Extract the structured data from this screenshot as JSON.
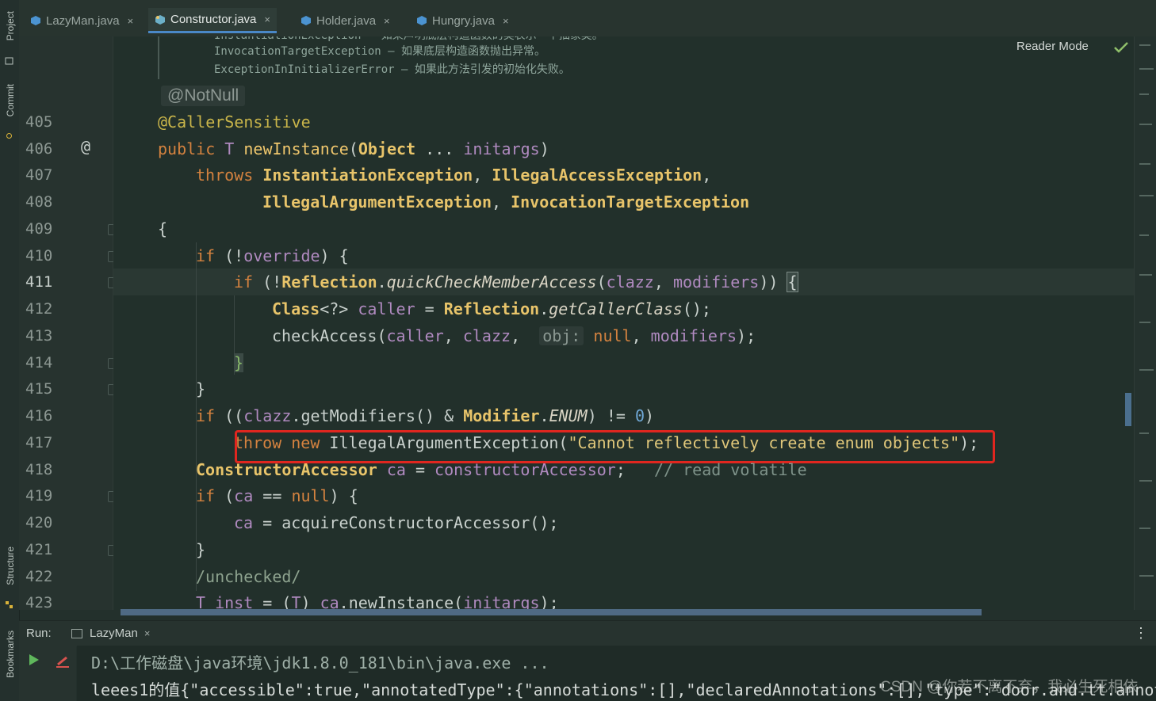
{
  "left_strip": {
    "project_label": "Project",
    "commit_label": "Commit",
    "structure_label": "Structure",
    "bookmarks_label": "Bookmarks"
  },
  "tabs": [
    {
      "label": "LazyMan.java",
      "active": false
    },
    {
      "label": "Constructor.java",
      "active": true
    },
    {
      "label": "Holder.java",
      "active": false
    },
    {
      "label": "Hungry.java",
      "active": false
    }
  ],
  "close_glyph": "×",
  "reader_mode": "Reader Mode",
  "doc": {
    "partial_line": "InstantiationException – 如果声明底层构造函数的类表示一个抽象类。",
    "line1": "InvocationTargetException – 如果底层构造函数抛出异常。",
    "line2": "ExceptionInInitializerError – 如果此方法引发的初始化失败。",
    "annotation": "@NotNull"
  },
  "gutter_marker": "@",
  "line_numbers": [
    "405",
    "406",
    "407",
    "408",
    "409",
    "410",
    "411",
    "412",
    "413",
    "414",
    "415",
    "416",
    "417",
    "418",
    "419",
    "420",
    "421",
    "422",
    "423"
  ],
  "code": {
    "l405": "@CallerSensitive",
    "l406_kw": "public ",
    "l406_type": "T ",
    "l406_fn": "newInstance",
    "l406_open": "(",
    "l406_cls": "Object",
    "l406_dots": " ... ",
    "l406_param": "initargs",
    "l406_close": ")",
    "l407_kw": "throws ",
    "l407_a": "InstantiationException",
    "l407_sep": ", ",
    "l407_b": "IllegalAccessException",
    "l407_end": ",",
    "l408_a": "IllegalArgumentException",
    "l408_sep": ", ",
    "l408_b": "InvocationTargetException",
    "l409": "{",
    "l410_kw": "if ",
    "l410_a": "(!",
    "l410_b": "override",
    "l410_c": ") {",
    "l411_kw": "if ",
    "l411_a": "(!",
    "l411_cls": "Reflection",
    "l411_dot": ".",
    "l411_fn": "quickCheckMemberAccess",
    "l411_b": "(",
    "l411_p1": "clazz",
    "l411_comma": ", ",
    "l411_p2": "modifiers",
    "l411_c": ")) ",
    "l411_brace": "{",
    "l412_cls": "Class",
    "l412_gen": "<?> ",
    "l412_var": "caller",
    "l412_eq": " = ",
    "l412_cls2": "Reflection",
    "l412_dot": ".",
    "l412_fn": "getCallerClass",
    "l412_end": "();",
    "l413_fn": "checkAccess",
    "l413_open": "(",
    "l413_p1": "caller",
    "l413_c1": ", ",
    "l413_p2": "clazz",
    "l413_c2": ",  ",
    "l413_hint": "obj:",
    "l413_null": " null",
    "l413_c3": ", ",
    "l413_p3": "modifiers",
    "l413_end": ");",
    "l414": "}",
    "l415": "}",
    "l416_kw": "if ",
    "l416_a": "((",
    "l416_p": "clazz",
    "l416_b": ".getModifiers() & ",
    "l416_cls": "Modifier",
    "l416_dot": ".",
    "l416_enum": "ENUM",
    "l416_c": ") != ",
    "l416_num": "0",
    "l416_d": ")",
    "l417_kw": "throw new ",
    "l417_cls": "IllegalArgumentException",
    "l417_open": "(",
    "l417_str": "\"Cannot reflectively create enum objects\"",
    "l417_end": ");",
    "l418_cls": "ConstructorAccessor",
    "l418_var": " ca",
    "l418_eq": " = ",
    "l418_field": "constructorAccessor",
    "l418_semi": ";",
    "l418_cmt": "   // read volatile",
    "l419_kw": "if ",
    "l419_a": "(",
    "l419_var": "ca",
    "l419_b": " == ",
    "l419_null": "null",
    "l419_c": ") {",
    "l420_var": "ca",
    "l420_rest": " = acquireConstructorAccessor();",
    "l421": "}",
    "l422": "/unchecked/",
    "l423_type": "T ",
    "l423_var": "inst",
    "l423_a": " = (",
    "l423_t": "T",
    "l423_b": ") ",
    "l423_ca": "ca",
    "l423_c": ".newInstance(",
    "l423_p": "initargs",
    "l423_d": ");"
  },
  "run": {
    "label": "Run:",
    "tab": "LazyMan",
    "more": "⋮",
    "console_line1": "D:\\工作磁盘\\java环境\\jdk1.8.0_181\\bin\\java.exe ...",
    "console_line2": "leees1的值{\"accessible\":true,\"annotatedType\":{\"annotations\":[],\"declaredAnnotations\":[],\"type\":\"door.and.tt.annot",
    "watermark": "CSDN @你若不离不弃，我必生死相依"
  },
  "colors": {
    "highlight_box": "#e0261f",
    "keyword": "#d4823f",
    "class": "#e8c46a",
    "string": "#88b96a"
  }
}
